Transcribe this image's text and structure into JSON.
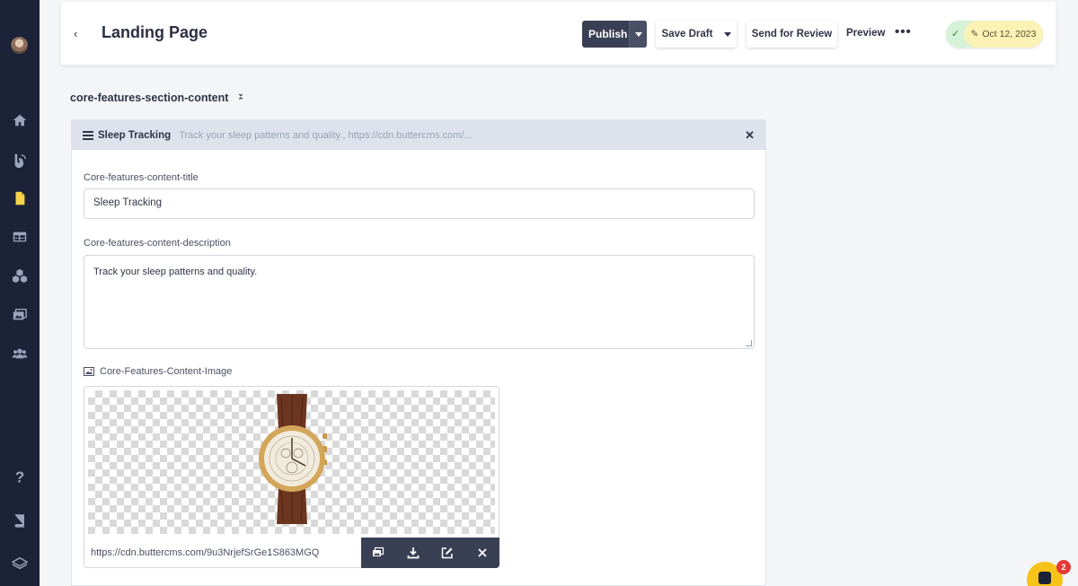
{
  "sidebar": {
    "items": [
      {
        "icon": "home-icon"
      },
      {
        "icon": "blog-icon"
      },
      {
        "icon": "pages-icon",
        "active_color": "#f5d44b"
      },
      {
        "icon": "collections-icon"
      },
      {
        "icon": "components-icon"
      },
      {
        "icon": "media-icon"
      },
      {
        "icon": "users-icon"
      },
      {
        "icon": "help-icon"
      },
      {
        "icon": "book-icon"
      },
      {
        "icon": "layers-icon"
      }
    ]
  },
  "header": {
    "back_label": "‹",
    "title": "Landing Page",
    "publish_label": "Publish",
    "save_draft_label": "Save Draft",
    "send_review_label": "Send for Review",
    "preview_label": "Preview",
    "more_label": "•••",
    "status_check": "✓",
    "date_label": "Oct 12, 2023",
    "date_icon": "✎"
  },
  "section": {
    "title": "core-features-section-content",
    "toggle": "⌄⌃"
  },
  "block": {
    "name": "Sleep Tracking",
    "summary": "Track your sleep patterns and quality., https://cdn.buttercms.com/...",
    "close": "✕",
    "title_label": "Core-features-content-title",
    "title_value": "Sleep Tracking",
    "description_label": "Core-features-content-description",
    "description_value": "Track your sleep patterns and quality.",
    "image_label": "Core-Features-Content-Image",
    "image_url": "https://cdn.buttercms.com/9u3NrjefSrGe1S863MGQ",
    "image_actions": [
      "gallery-icon",
      "download-icon",
      "edit-icon",
      "remove-icon"
    ]
  },
  "chat": {
    "badge_count": "2"
  },
  "colors": {
    "sidebar_bg": "#1c2237",
    "primary_dark": "#3a4054",
    "status_green": "#d6f2d8",
    "date_yellow": "#fbf2b6",
    "chat_yellow": "#f6c318",
    "badge_red": "#e53935"
  }
}
